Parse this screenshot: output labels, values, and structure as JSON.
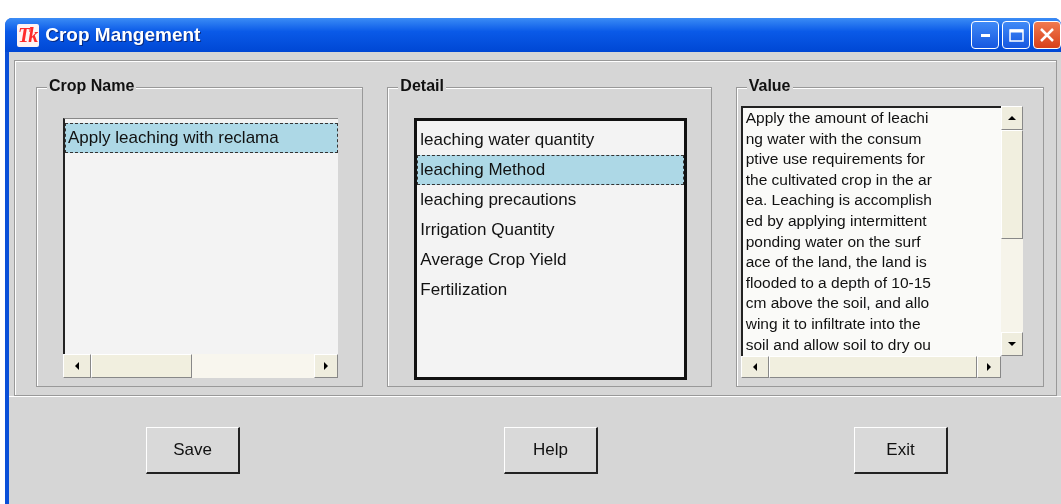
{
  "window": {
    "app_icon": "Tk",
    "title": "Crop Mangement"
  },
  "crop_name": {
    "label": "Crop Name",
    "items": [
      {
        "text": "Apply leaching with reclama",
        "selected": true
      }
    ]
  },
  "detail": {
    "label": "Detail",
    "items": [
      {
        "text": "leaching water quantity",
        "selected": false
      },
      {
        "text": "leaching Method",
        "selected": true
      },
      {
        "text": "leaching precautions",
        "selected": false
      },
      {
        "text": "Irrigation Quantity",
        "selected": false
      },
      {
        "text": "Average Crop Yield",
        "selected": false
      },
      {
        "text": "Fertilization",
        "selected": false
      }
    ]
  },
  "value": {
    "label": "Value",
    "lines": [
      "Apply the amount of leachi",
      "ng water with the consum",
      "ptive use requirements for",
      "the cultivated crop in the ar",
      "ea. Leaching is accomplish",
      "ed by applying intermittent",
      "ponding water on the surf",
      "ace of the land, the land is",
      "flooded to a depth of 10-15",
      "cm above the soil, and allo",
      "wing it to infiltrate into the",
      "soil and allow soil to dry ou"
    ]
  },
  "buttons": [
    {
      "label": "Save"
    },
    {
      "label": "Help"
    },
    {
      "label": "Exit"
    }
  ]
}
